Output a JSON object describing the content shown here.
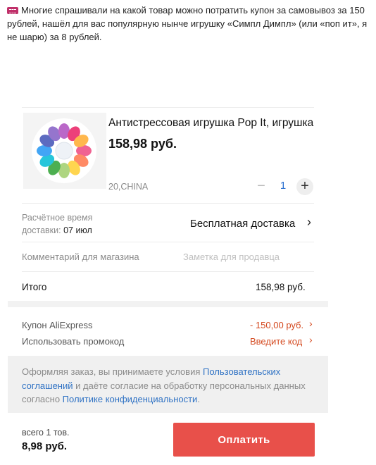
{
  "post": {
    "icon": "ticket-icon",
    "text": "Многие спрашивали на какой товар можно потратить купон за самовывоз за 150 рублей, нашёл для вас популярную нынче игрушку «Симпл Димпл» (или «поп ит», я не шарю) за 8 рублей."
  },
  "product": {
    "image_icon": "pop-it-flower-toy-image",
    "title": "Антистрессовая игрушка Pop It, игрушка",
    "price": "158,98 руб.",
    "variant": "20,CHINA",
    "quantity": "1",
    "minus_label": "−",
    "plus_label": "+"
  },
  "delivery": {
    "label_line1": "Расчётное время",
    "label_line2": "доставки: ",
    "date": "07 июл",
    "value": "Бесплатная доставка"
  },
  "comment": {
    "label": "Комментарий для магазина",
    "placeholder": "Заметка для продавца"
  },
  "total": {
    "label": "Итого",
    "value": "158,98 руб."
  },
  "coupon": {
    "label": "Купон AliExpress",
    "value": "- 150,00 руб."
  },
  "promo": {
    "label": "Использовать промокод",
    "value": "Введите код"
  },
  "terms": {
    "part1": "Оформляя заказ, вы принимаете условия ",
    "link1": "Пользовательских соглашений",
    "part2": " и даёте согласие на обработку персональных данных согласно ",
    "link2": "Политике конфиденциальности",
    "part3": "."
  },
  "footer": {
    "items_count": "всего 1 тов.",
    "grand_total": "8,98 руб.",
    "pay_label": "Оплатить"
  },
  "colors": {
    "accent": "#e8504a",
    "coupon": "#d4491f",
    "link": "#2f72c4"
  }
}
